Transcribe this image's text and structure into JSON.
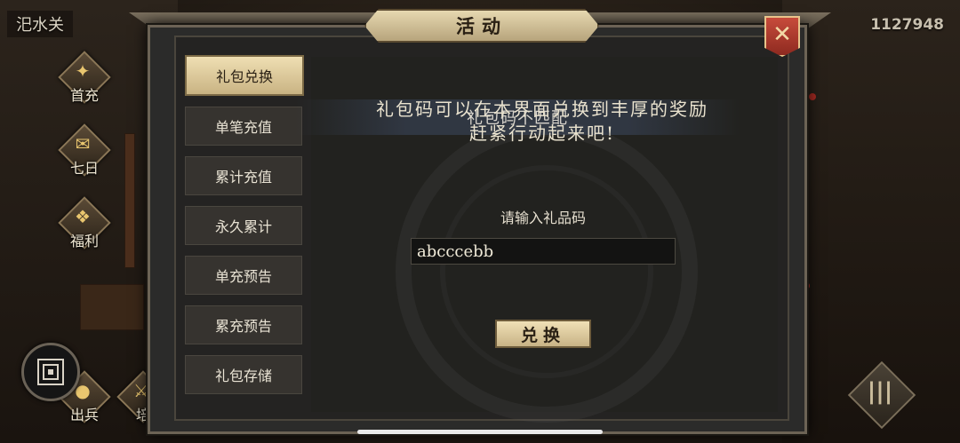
{
  "hud": {
    "location": "汜水关",
    "currency": "1127948"
  },
  "side_menu": [
    {
      "label": "首充",
      "icon": "gift-box-icon"
    },
    {
      "label": "七日",
      "icon": "scroll-icon"
    },
    {
      "label": "福利",
      "icon": "treasure-icon"
    },
    {
      "label": "出兵",
      "icon": "drum-icon"
    },
    {
      "label": "培",
      "icon": "sword-icon"
    }
  ],
  "panel": {
    "title": "活动",
    "tabs": [
      {
        "label": "礼包兑换",
        "active": true
      },
      {
        "label": "单笔充值",
        "active": false
      },
      {
        "label": "累计充值",
        "active": false
      },
      {
        "label": "永久累计",
        "active": false
      },
      {
        "label": "单充预告",
        "active": false
      },
      {
        "label": "累充预告",
        "active": false
      },
      {
        "label": "礼包存储",
        "active": false
      }
    ],
    "description_line1": "礼包码可以在本界面兑换到丰厚的奖励",
    "description_line2": "赶紧行动起来吧!",
    "toast": "礼包码不匹配",
    "input_prompt": "请输入礼品码",
    "input_value": "abcccebb",
    "redeem_label": "兑换"
  },
  "colors": {
    "accent_gold": "#e6d8b0",
    "close_red": "#c74b3b",
    "panel_bg": "#242322"
  }
}
